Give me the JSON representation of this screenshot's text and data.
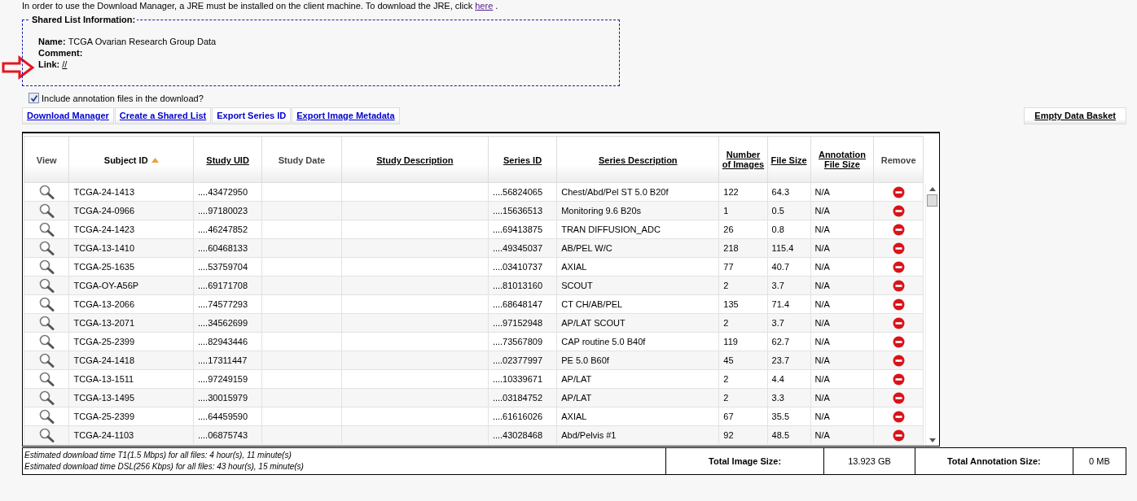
{
  "notice": {
    "text": "In order to use the Download Manager, a JRE must be installed on the client machine. To download the JRE, click",
    "link": "here",
    "after": "."
  },
  "shared_list": {
    "legend": "Shared List Information:",
    "fields": [
      {
        "label": "Name:",
        "value": "TCGA Ovarian Research Group Data"
      },
      {
        "label": "Comment:"
      },
      {
        "label": "Link:",
        "link": "//"
      }
    ]
  },
  "include_annotations": {
    "label": "Include annotation files in the download?",
    "checked": true
  },
  "actions": [
    "Download Manager",
    "Create a Shared List",
    "Export Series ID",
    "Export Image Metadata"
  ],
  "empty_basket": "Empty Data Basket",
  "table": {
    "view_column": "View",
    "remove_column": "Remove",
    "columns": [
      {
        "label": "Subject ID",
        "link": false,
        "sorted": true
      },
      {
        "label": "Study UID",
        "link": true,
        "sorted": false
      },
      {
        "label": "Study Date",
        "link": false,
        "sorted": false
      },
      {
        "label": "Study Description",
        "link": true,
        "sorted": false
      },
      {
        "label": "Series ID",
        "link": true,
        "sorted": false
      },
      {
        "label": "Series Description",
        "link": true,
        "sorted": false
      },
      {
        "label": "Number of Images",
        "link": true,
        "sorted": false
      },
      {
        "label": "File Size",
        "link": true,
        "sorted": false
      },
      {
        "label": "Annotation File Size",
        "link": true,
        "sorted": false
      }
    ],
    "rows": [
      [
        "TCGA-24-1413",
        "....43472950",
        "",
        "",
        "....56824065",
        "Chest/Abd/Pel ST 5.0 B20f",
        "122",
        "64.3",
        "N/A"
      ],
      [
        "TCGA-24-0966",
        "....97180023",
        "",
        "",
        "....15636513",
        "Monitoring 9.6 B20s",
        "1",
        "0.5",
        "N/A"
      ],
      [
        "TCGA-24-1423",
        "....46247852",
        "",
        "",
        "....69413875",
        "TRAN DIFFUSION_ADC",
        "26",
        "0.8",
        "N/A"
      ],
      [
        "TCGA-13-1410",
        "....60468133",
        "",
        "",
        "....49345037",
        "AB/PEL W/C",
        "218",
        "115.4",
        "N/A"
      ],
      [
        "TCGA-25-1635",
        "....53759704",
        "",
        "",
        "....03410737",
        "AXIAL",
        "77",
        "40.7",
        "N/A"
      ],
      [
        "TCGA-OY-A56P",
        "....69171708",
        "",
        "",
        "....81013160",
        "SCOUT",
        "2",
        "3.7",
        "N/A"
      ],
      [
        "TCGA-13-2066",
        "....74577293",
        "",
        "",
        "....68648147",
        "CT CH/AB/PEL",
        "135",
        "71.4",
        "N/A"
      ],
      [
        "TCGA-13-2071",
        "....34562699",
        "",
        "",
        "....97152948",
        "AP/LAT SCOUT",
        "2",
        "3.7",
        "N/A"
      ],
      [
        "TCGA-25-2399",
        "....82943446",
        "",
        "",
        "....73567809",
        "CAP routine 5.0 B40f",
        "119",
        "62.7",
        "N/A"
      ],
      [
        "TCGA-24-1418",
        "....17311447",
        "",
        "",
        "....02377997",
        "PE 5.0 B60f",
        "45",
        "23.7",
        "N/A"
      ],
      [
        "TCGA-13-1511",
        "....97249159",
        "",
        "",
        "....10339671",
        "AP/LAT",
        "2",
        "4.4",
        "N/A"
      ],
      [
        "TCGA-13-1495",
        "....30015979",
        "",
        "",
        "....03184752",
        "AP/LAT",
        "2",
        "3.3",
        "N/A"
      ],
      [
        "TCGA-25-2399",
        "....64459590",
        "",
        "",
        "....61616026",
        "AXIAL",
        "67",
        "35.5",
        "N/A"
      ],
      [
        "TCGA-24-1103",
        "....06875743",
        "",
        "",
        "....43028468",
        "Abd/Pelvis #1",
        "92",
        "48.5",
        "N/A"
      ]
    ]
  },
  "summary": {
    "estimates": [
      "Estimated download time T1(1.5 Mbps) for all files: 4 hour(s), 11 minute(s)",
      "Estimated download time DSL(256 Kbps) for all files: 43 hour(s), 15 minute(s)"
    ],
    "image_size_label": "Total Image Size:",
    "image_size": "13.923 GB",
    "annotation_size_label": "Total Annotation Size:",
    "annotation_size": "0 MB"
  }
}
